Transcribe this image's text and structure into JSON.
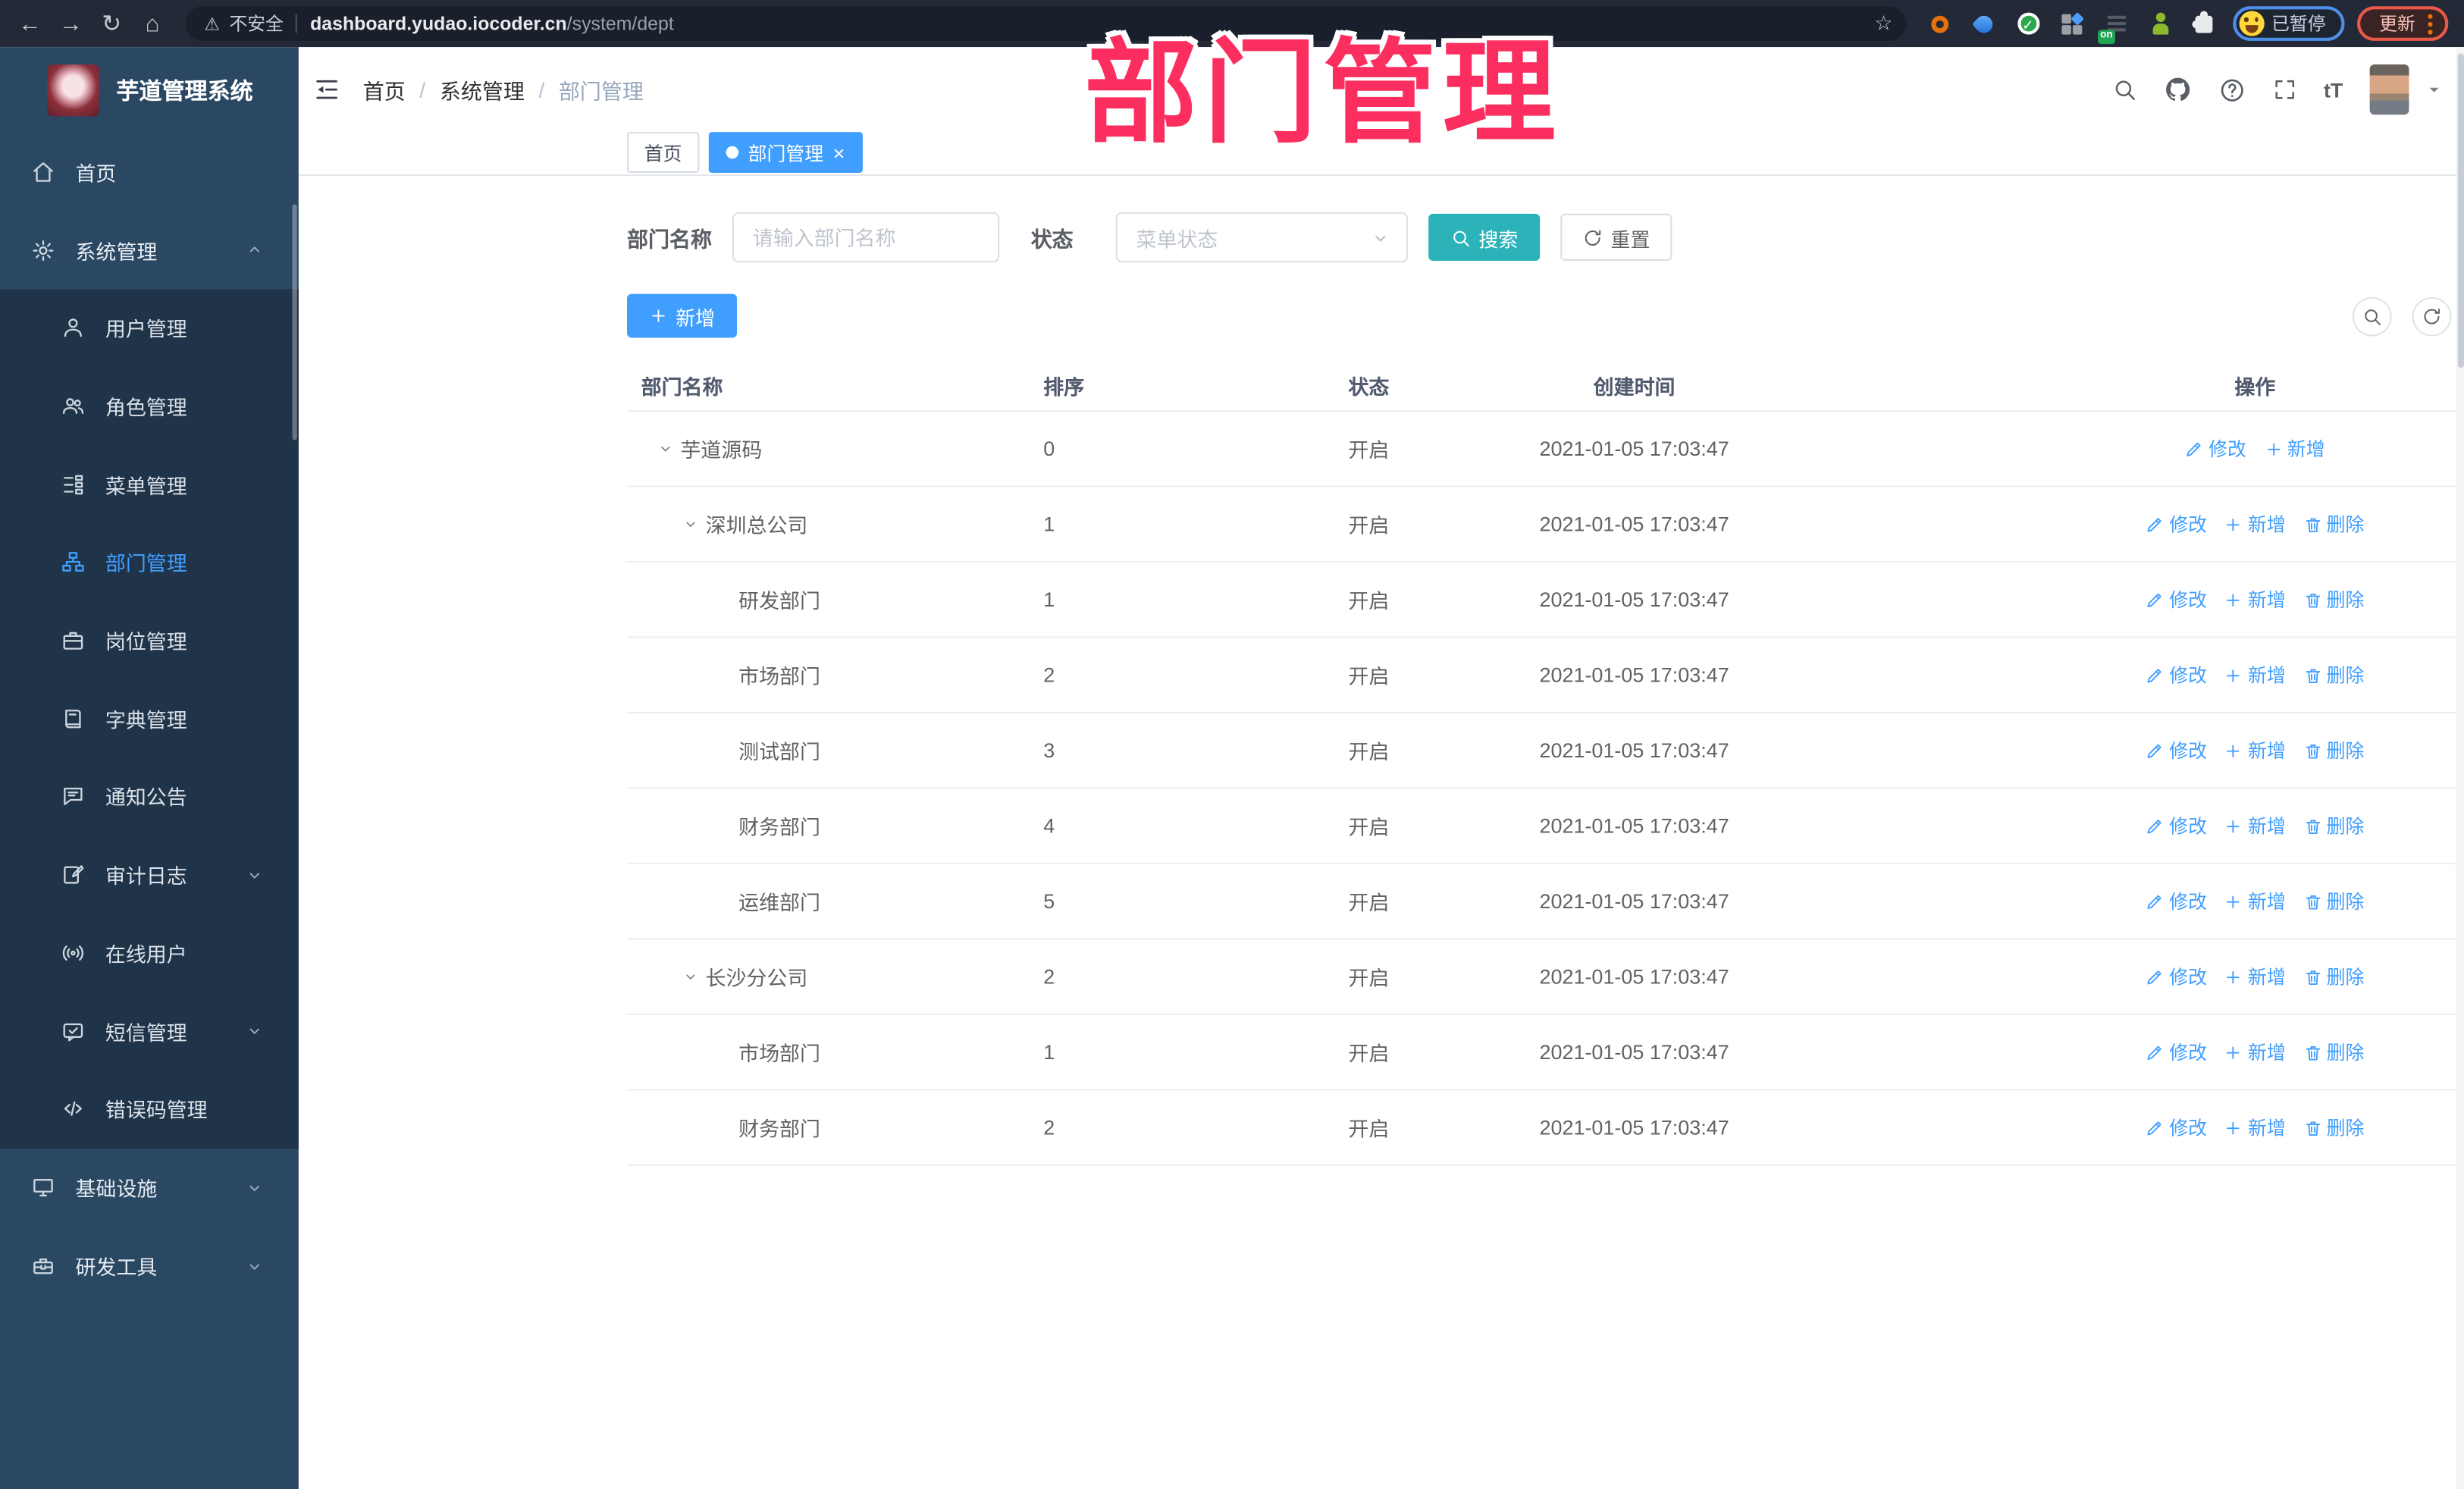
{
  "colors": {
    "accent_blue": "#409eff",
    "accent_teal": "#2bb3b9",
    "watermark_pink": "#fb2e5f",
    "sidebar_bg": "#2b4863",
    "submenu_bg": "#203449",
    "toolbar_bg": "#232936",
    "omnibox_bg": "#1a202b"
  },
  "watermark": "部门管理",
  "browser": {
    "security_label": "不安全",
    "url_host": "dashboard.yudao.iocoder.cn",
    "url_path": "/system/dept",
    "extensions_badge": "on",
    "profile_label": "已暂停",
    "update_label": "更新"
  },
  "sidebar": {
    "title": "芋道管理系统",
    "items": [
      {
        "id": "home",
        "label": "首页",
        "icon": "home",
        "sub": false,
        "chevron": ""
      },
      {
        "id": "system",
        "label": "系统管理",
        "icon": "gear",
        "sub": false,
        "chevron": "up"
      },
      {
        "id": "user",
        "label": "用户管理",
        "icon": "user",
        "sub": true,
        "chevron": ""
      },
      {
        "id": "role",
        "label": "角色管理",
        "icon": "users",
        "sub": true,
        "chevron": ""
      },
      {
        "id": "menu",
        "label": "菜单管理",
        "icon": "menu",
        "sub": true,
        "chevron": ""
      },
      {
        "id": "dept",
        "label": "部门管理",
        "icon": "dept",
        "sub": true,
        "chevron": "",
        "active": true
      },
      {
        "id": "post",
        "label": "岗位管理",
        "icon": "post",
        "sub": true,
        "chevron": ""
      },
      {
        "id": "dict",
        "label": "字典管理",
        "icon": "dict",
        "sub": true,
        "chevron": ""
      },
      {
        "id": "notice",
        "label": "通知公告",
        "icon": "notice",
        "sub": true,
        "chevron": ""
      },
      {
        "id": "audit",
        "label": "审计日志",
        "icon": "audit",
        "sub": true,
        "chevron": "down"
      },
      {
        "id": "online",
        "label": "在线用户",
        "icon": "online",
        "sub": true,
        "chevron": ""
      },
      {
        "id": "sms",
        "label": "短信管理",
        "icon": "sms",
        "sub": true,
        "chevron": "down"
      },
      {
        "id": "errcode",
        "label": "错误码管理",
        "icon": "errcode",
        "sub": true,
        "chevron": ""
      },
      {
        "id": "infra",
        "label": "基础设施",
        "icon": "infra",
        "sub": false,
        "chevron": "down"
      },
      {
        "id": "devtool",
        "label": "研发工具",
        "icon": "devtool",
        "sub": false,
        "chevron": "down"
      }
    ]
  },
  "header": {
    "breadcrumb": [
      "首页",
      "系统管理",
      "部门管理"
    ],
    "icons": [
      "search",
      "github",
      "help",
      "fullscreen",
      "font-size"
    ]
  },
  "tabs": [
    {
      "label": "首页",
      "active": false
    },
    {
      "label": "部门管理",
      "active": true
    }
  ],
  "filters": {
    "dept_label": "部门名称",
    "dept_placeholder": "请输入部门名称",
    "status_label": "状态",
    "status_placeholder": "菜单状态",
    "search_label": "搜索",
    "reset_label": "重置"
  },
  "toolbar": {
    "add_label": "新增"
  },
  "table": {
    "columns": [
      "部门名称",
      "排序",
      "状态",
      "创建时间",
      "操作"
    ],
    "rows": [
      {
        "name": "芋道源码",
        "level": 0,
        "expandable": true,
        "sort": "0",
        "status": "开启",
        "created": "2021-01-05 17:03:47",
        "actions": [
          "修改",
          "新增"
        ]
      },
      {
        "name": "深圳总公司",
        "level": 1,
        "expandable": true,
        "sort": "1",
        "status": "开启",
        "created": "2021-01-05 17:03:47",
        "actions": [
          "修改",
          "新增",
          "删除"
        ]
      },
      {
        "name": "研发部门",
        "level": 2,
        "expandable": false,
        "sort": "1",
        "status": "开启",
        "created": "2021-01-05 17:03:47",
        "actions": [
          "修改",
          "新增",
          "删除"
        ]
      },
      {
        "name": "市场部门",
        "level": 2,
        "expandable": false,
        "sort": "2",
        "status": "开启",
        "created": "2021-01-05 17:03:47",
        "actions": [
          "修改",
          "新增",
          "删除"
        ]
      },
      {
        "name": "测试部门",
        "level": 2,
        "expandable": false,
        "sort": "3",
        "status": "开启",
        "created": "2021-01-05 17:03:47",
        "actions": [
          "修改",
          "新增",
          "删除"
        ]
      },
      {
        "name": "财务部门",
        "level": 2,
        "expandable": false,
        "sort": "4",
        "status": "开启",
        "created": "2021-01-05 17:03:47",
        "actions": [
          "修改",
          "新增",
          "删除"
        ]
      },
      {
        "name": "运维部门",
        "level": 2,
        "expandable": false,
        "sort": "5",
        "status": "开启",
        "created": "2021-01-05 17:03:47",
        "actions": [
          "修改",
          "新增",
          "删除"
        ]
      },
      {
        "name": "长沙分公司",
        "level": 1,
        "expandable": true,
        "sort": "2",
        "status": "开启",
        "created": "2021-01-05 17:03:47",
        "actions": [
          "修改",
          "新增",
          "删除"
        ]
      },
      {
        "name": "市场部门",
        "level": 2,
        "expandable": false,
        "sort": "1",
        "status": "开启",
        "created": "2021-01-05 17:03:47",
        "actions": [
          "修改",
          "新增",
          "删除"
        ]
      },
      {
        "name": "财务部门",
        "level": 2,
        "expandable": false,
        "sort": "2",
        "status": "开启",
        "created": "2021-01-05 17:03:47",
        "actions": [
          "修改",
          "新增",
          "删除"
        ]
      }
    ]
  }
}
